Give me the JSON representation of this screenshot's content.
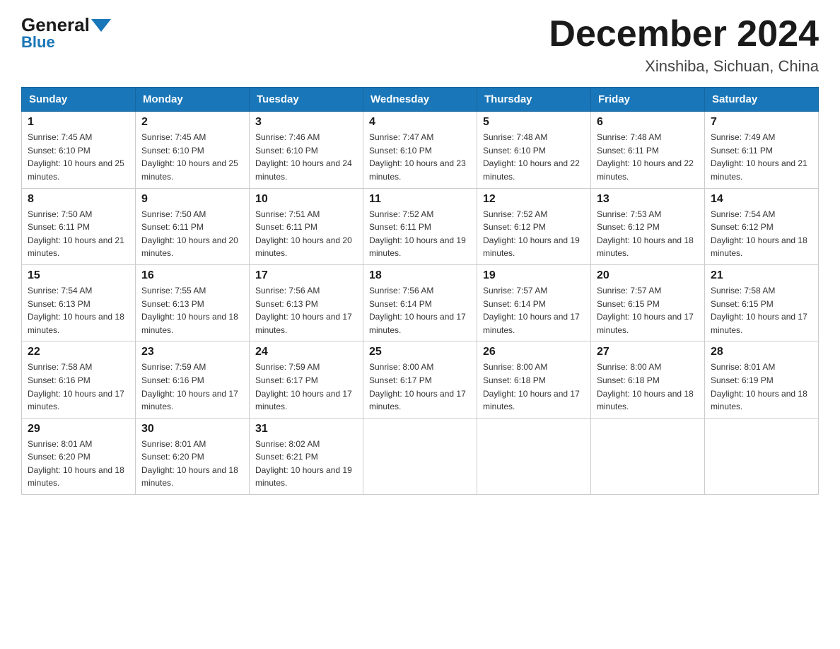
{
  "header": {
    "logo_general": "General",
    "logo_blue": "Blue",
    "title": "December 2024",
    "location": "Xinshiba, Sichuan, China"
  },
  "days_of_week": [
    "Sunday",
    "Monday",
    "Tuesday",
    "Wednesday",
    "Thursday",
    "Friday",
    "Saturday"
  ],
  "weeks": [
    [
      {
        "day": "1",
        "sunrise": "7:45 AM",
        "sunset": "6:10 PM",
        "daylight": "10 hours and 25 minutes."
      },
      {
        "day": "2",
        "sunrise": "7:45 AM",
        "sunset": "6:10 PM",
        "daylight": "10 hours and 25 minutes."
      },
      {
        "day": "3",
        "sunrise": "7:46 AM",
        "sunset": "6:10 PM",
        "daylight": "10 hours and 24 minutes."
      },
      {
        "day": "4",
        "sunrise": "7:47 AM",
        "sunset": "6:10 PM",
        "daylight": "10 hours and 23 minutes."
      },
      {
        "day": "5",
        "sunrise": "7:48 AM",
        "sunset": "6:10 PM",
        "daylight": "10 hours and 22 minutes."
      },
      {
        "day": "6",
        "sunrise": "7:48 AM",
        "sunset": "6:11 PM",
        "daylight": "10 hours and 22 minutes."
      },
      {
        "day": "7",
        "sunrise": "7:49 AM",
        "sunset": "6:11 PM",
        "daylight": "10 hours and 21 minutes."
      }
    ],
    [
      {
        "day": "8",
        "sunrise": "7:50 AM",
        "sunset": "6:11 PM",
        "daylight": "10 hours and 21 minutes."
      },
      {
        "day": "9",
        "sunrise": "7:50 AM",
        "sunset": "6:11 PM",
        "daylight": "10 hours and 20 minutes."
      },
      {
        "day": "10",
        "sunrise": "7:51 AM",
        "sunset": "6:11 PM",
        "daylight": "10 hours and 20 minutes."
      },
      {
        "day": "11",
        "sunrise": "7:52 AM",
        "sunset": "6:11 PM",
        "daylight": "10 hours and 19 minutes."
      },
      {
        "day": "12",
        "sunrise": "7:52 AM",
        "sunset": "6:12 PM",
        "daylight": "10 hours and 19 minutes."
      },
      {
        "day": "13",
        "sunrise": "7:53 AM",
        "sunset": "6:12 PM",
        "daylight": "10 hours and 18 minutes."
      },
      {
        "day": "14",
        "sunrise": "7:54 AM",
        "sunset": "6:12 PM",
        "daylight": "10 hours and 18 minutes."
      }
    ],
    [
      {
        "day": "15",
        "sunrise": "7:54 AM",
        "sunset": "6:13 PM",
        "daylight": "10 hours and 18 minutes."
      },
      {
        "day": "16",
        "sunrise": "7:55 AM",
        "sunset": "6:13 PM",
        "daylight": "10 hours and 18 minutes."
      },
      {
        "day": "17",
        "sunrise": "7:56 AM",
        "sunset": "6:13 PM",
        "daylight": "10 hours and 17 minutes."
      },
      {
        "day": "18",
        "sunrise": "7:56 AM",
        "sunset": "6:14 PM",
        "daylight": "10 hours and 17 minutes."
      },
      {
        "day": "19",
        "sunrise": "7:57 AM",
        "sunset": "6:14 PM",
        "daylight": "10 hours and 17 minutes."
      },
      {
        "day": "20",
        "sunrise": "7:57 AM",
        "sunset": "6:15 PM",
        "daylight": "10 hours and 17 minutes."
      },
      {
        "day": "21",
        "sunrise": "7:58 AM",
        "sunset": "6:15 PM",
        "daylight": "10 hours and 17 minutes."
      }
    ],
    [
      {
        "day": "22",
        "sunrise": "7:58 AM",
        "sunset": "6:16 PM",
        "daylight": "10 hours and 17 minutes."
      },
      {
        "day": "23",
        "sunrise": "7:59 AM",
        "sunset": "6:16 PM",
        "daylight": "10 hours and 17 minutes."
      },
      {
        "day": "24",
        "sunrise": "7:59 AM",
        "sunset": "6:17 PM",
        "daylight": "10 hours and 17 minutes."
      },
      {
        "day": "25",
        "sunrise": "8:00 AM",
        "sunset": "6:17 PM",
        "daylight": "10 hours and 17 minutes."
      },
      {
        "day": "26",
        "sunrise": "8:00 AM",
        "sunset": "6:18 PM",
        "daylight": "10 hours and 17 minutes."
      },
      {
        "day": "27",
        "sunrise": "8:00 AM",
        "sunset": "6:18 PM",
        "daylight": "10 hours and 18 minutes."
      },
      {
        "day": "28",
        "sunrise": "8:01 AM",
        "sunset": "6:19 PM",
        "daylight": "10 hours and 18 minutes."
      }
    ],
    [
      {
        "day": "29",
        "sunrise": "8:01 AM",
        "sunset": "6:20 PM",
        "daylight": "10 hours and 18 minutes."
      },
      {
        "day": "30",
        "sunrise": "8:01 AM",
        "sunset": "6:20 PM",
        "daylight": "10 hours and 18 minutes."
      },
      {
        "day": "31",
        "sunrise": "8:02 AM",
        "sunset": "6:21 PM",
        "daylight": "10 hours and 19 minutes."
      },
      null,
      null,
      null,
      null
    ]
  ],
  "labels": {
    "sunrise_prefix": "Sunrise: ",
    "sunset_prefix": "Sunset: ",
    "daylight_prefix": "Daylight: "
  }
}
